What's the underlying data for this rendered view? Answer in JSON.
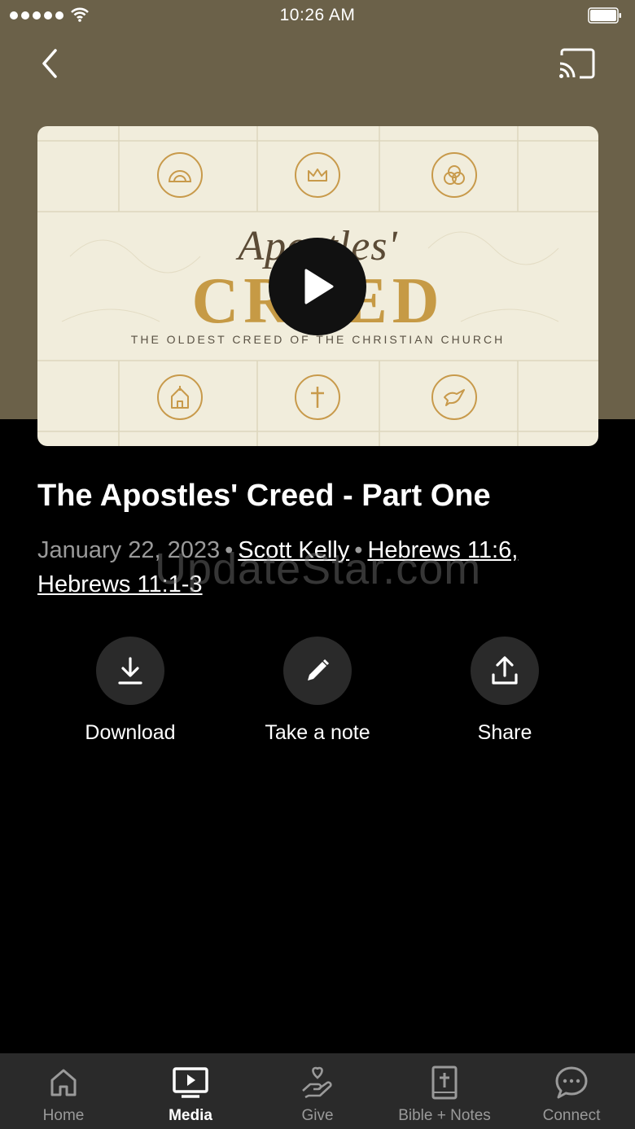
{
  "status_bar": {
    "time": "10:26 AM"
  },
  "video": {
    "script_title": "Apostles'",
    "main_title": "CREED",
    "subtitle": "THE OLDEST CREED OF THE CHRISTIAN CHURCH"
  },
  "sermon": {
    "title": "The Apostles' Creed - Part One",
    "date": "January 22, 2023",
    "speaker": "Scott Kelly",
    "scripture_1": "Hebrews 11:6,",
    "scripture_2": "Hebrews 11:1-3"
  },
  "watermark": "UpdateStar.com",
  "actions": {
    "download": "Download",
    "note": "Take a note",
    "share": "Share"
  },
  "tabs": {
    "home": "Home",
    "media": "Media",
    "give": "Give",
    "bible": "Bible + Notes",
    "connect": "Connect"
  },
  "colors": {
    "header_bg": "#6b6149",
    "gold": "#c69a45",
    "tab_bg": "#2a2a2a"
  }
}
